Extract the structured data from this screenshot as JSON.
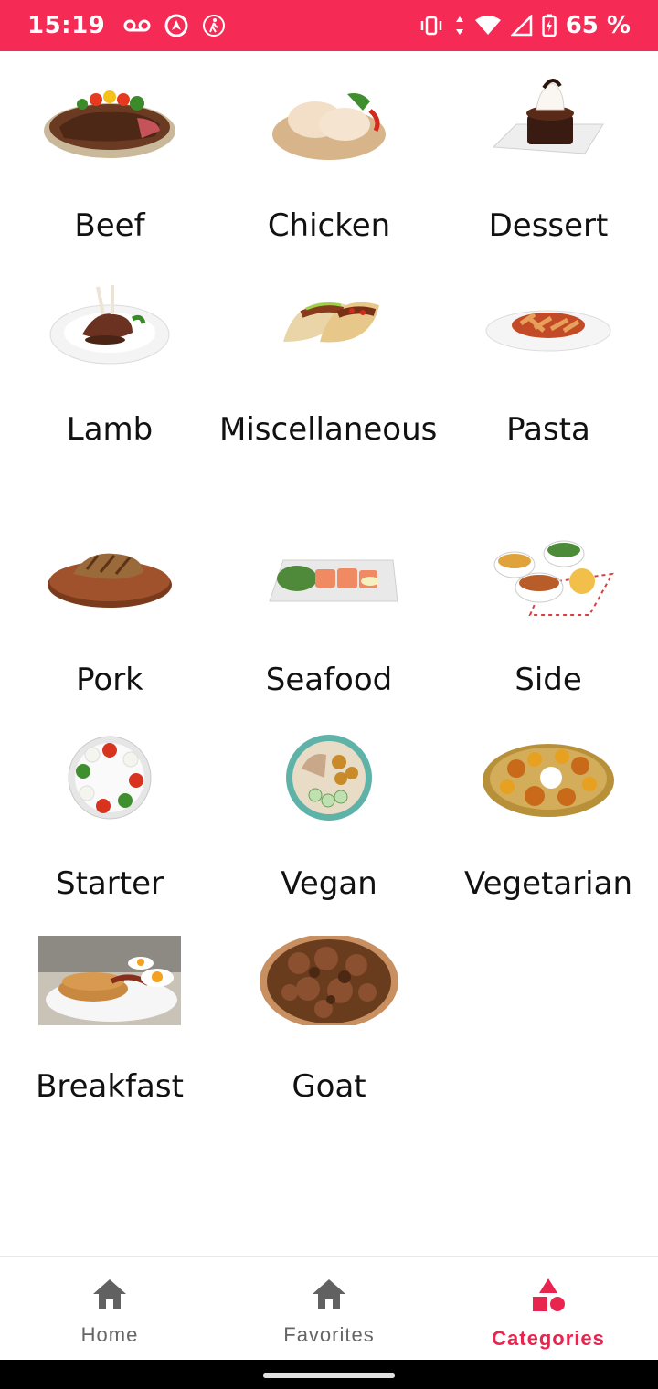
{
  "status_bar": {
    "time": "15:19",
    "battery": "65 %",
    "icons": [
      "voicemail-icon",
      "nav-app-icon",
      "walk-icon",
      "vibrate-icon",
      "wifi-icon",
      "signal-icon",
      "battery-icon"
    ]
  },
  "categories": [
    {
      "name": "Beef",
      "icon": "beef-thumbnail"
    },
    {
      "name": "Chicken",
      "icon": "chicken-thumbnail"
    },
    {
      "name": "Dessert",
      "icon": "dessert-thumbnail"
    },
    {
      "name": "Lamb",
      "icon": "lamb-thumbnail"
    },
    {
      "name": "Miscellaneous",
      "icon": "miscellaneous-thumbnail"
    },
    {
      "name": "Pasta",
      "icon": "pasta-thumbnail"
    },
    {
      "name": "Pork",
      "icon": "pork-thumbnail"
    },
    {
      "name": "Seafood",
      "icon": "seafood-thumbnail"
    },
    {
      "name": "Side",
      "icon": "side-thumbnail"
    },
    {
      "name": "Starter",
      "icon": "starter-thumbnail"
    },
    {
      "name": "Vegan",
      "icon": "vegan-thumbnail"
    },
    {
      "name": "Vegetarian",
      "icon": "vegetarian-thumbnail"
    },
    {
      "name": "Breakfast",
      "icon": "breakfast-thumbnail"
    },
    {
      "name": "Goat",
      "icon": "goat-thumbnail"
    }
  ],
  "bottom_nav": {
    "items": [
      {
        "label": "Home",
        "icon": "home-icon",
        "active": false
      },
      {
        "label": "Favorites",
        "icon": "home-icon",
        "active": false
      },
      {
        "label": "Categories",
        "icon": "categories-icon",
        "active": true
      }
    ]
  },
  "colors": {
    "accent": "#f52a55",
    "active": "#e8254f",
    "inactive": "#666666"
  }
}
